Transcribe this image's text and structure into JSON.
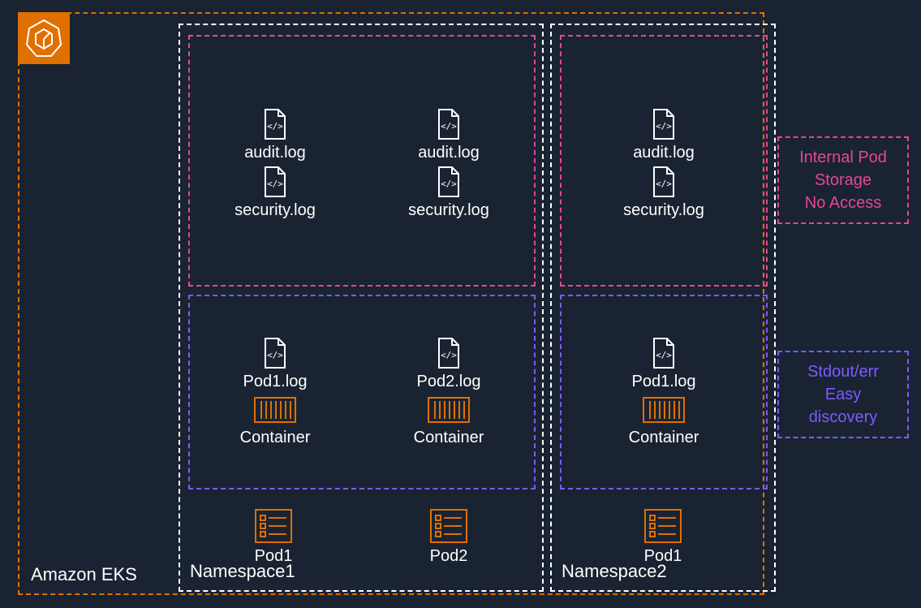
{
  "eks": {
    "label": "Amazon EKS"
  },
  "namespaces": {
    "ns1": {
      "label": "Namespace1",
      "internal": {
        "col1": {
          "file1": "audit.log",
          "file2": "security.log"
        },
        "col2": {
          "file1": "audit.log",
          "file2": "security.log"
        }
      },
      "stdout": {
        "col1": {
          "log": "Pod1.log",
          "container": "Container"
        },
        "col2": {
          "log": "Pod2.log",
          "container": "Container"
        }
      },
      "pods": {
        "col1": "Pod1",
        "col2": "Pod2"
      }
    },
    "ns2": {
      "label": "Namespace2",
      "internal": {
        "col1": {
          "file1": "audit.log",
          "file2": "security.log"
        }
      },
      "stdout": {
        "col1": {
          "log": "Pod1.log",
          "container": "Container"
        }
      },
      "pods": {
        "col1": "Pod1"
      }
    }
  },
  "legend": {
    "internal": {
      "line1": "Internal Pod",
      "line2": "Storage",
      "line3": "No Access"
    },
    "stdout": {
      "line1": "Stdout/err",
      "line2": "Easy discovery"
    }
  }
}
